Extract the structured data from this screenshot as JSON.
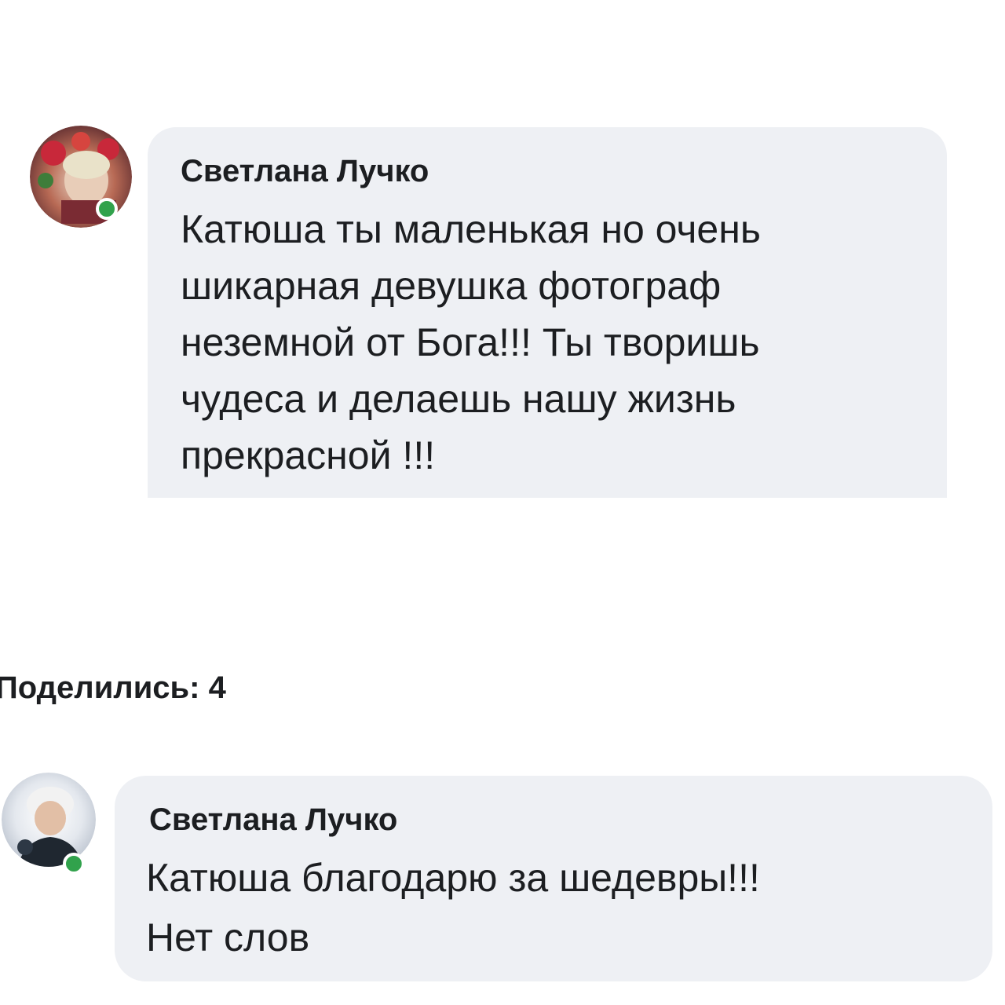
{
  "comments": [
    {
      "author": "Светлана Лучко",
      "text": "Катюша ты маленькая но очень\nшикарная девушка фотограф\nнеземной от Бога!!! Ты творишь\nчудеса и делаешь нашу жизнь\nпрекрасной !!!",
      "avatar_icon": "profile-photo-avatar",
      "online": true
    },
    {
      "author": "Светлана Лучко",
      "text": "Катюша благодарю за шедевры!!!\nНет слов",
      "avatar_icon": "profile-photo-avatar",
      "online": true
    }
  ],
  "shares": {
    "label": "Поделились: 4"
  },
  "colors": {
    "bubble": "#eef0f4",
    "online": "#31a24c",
    "text": "#1c1e21"
  }
}
